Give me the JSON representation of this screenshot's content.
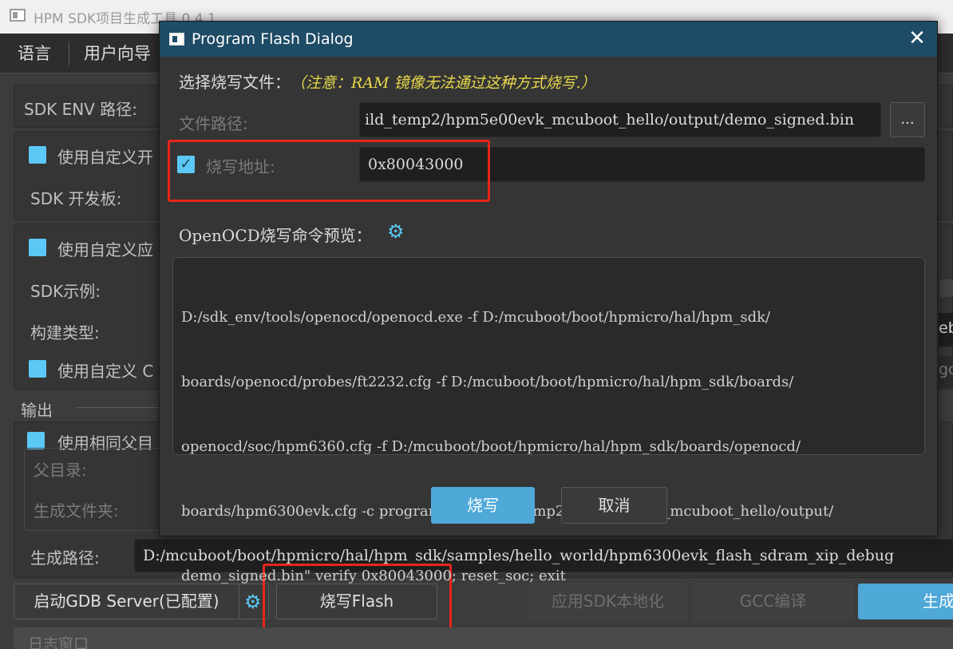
{
  "main_window": {
    "title": "HPM SDK项目生成工具 0.4.1",
    "menu": [
      "语言",
      "用户向导"
    ],
    "sdk_env_label": "SDK ENV 路径:",
    "custom_board_check": "使用自定义开",
    "sdk_board_label": "SDK 开发板:",
    "custom_app_check": "使用自定义应",
    "sdk_example_label": "SDK示例:",
    "build_type_label": "构建类型:",
    "custom_c_check": "使用自定义 C",
    "output_group": "输出",
    "same_parent_check": "使用相同父目",
    "parent_dir_label": "父目录:",
    "gen_folder_label": "生成文件夹:",
    "gen_path_label": "生成路径:",
    "gen_path_value": "D:/mcuboot/boot/hpmicro/hal/hpm_sdk/samples/hello_world/hpm6300evk_flash_sdram_xip_debug",
    "right_edge_fragment": "ebu",
    "right_edge_fragment2": "gc",
    "right_edge_fragment3": "具",
    "gdb_button": "启动GDB Server(已配置)",
    "flash_button": "烧写Flash",
    "localize_button": "应用SDK本地化",
    "gcc_button": "GCC编译",
    "generate_button": "生成",
    "log_window": "日志窗口"
  },
  "dialog": {
    "title": "Program Flash Dialog",
    "select_label": "选择烧写文件：",
    "note": "（注意：RAM 镜像无法通过这种方式烧写.）",
    "file_path_label": "文件路径:",
    "file_path_value": "ild_temp2/hpm5e00evk_mcuboot_hello/output/demo_signed.bin",
    "browse_button": "...",
    "address_label": "烧写地址:",
    "address_value": "0x80043000",
    "address_checked": true,
    "preview_label": "OpenOCD烧写命令预览：",
    "command_lines": [
      "D:/sdk_env/tools/openocd/openocd.exe -f D:/mcuboot/boot/hpmicro/hal/hpm_sdk/",
      "boards/openocd/probes/ft2232.cfg -f D:/mcuboot/boot/hpmicro/hal/hpm_sdk/boards/",
      "openocd/soc/hpm6360.cfg -f D:/mcuboot/boot/hpmicro/hal/hpm_sdk/boards/openocd/",
      "boards/hpm6300evk.cfg -c program \"D:/build_temp2/hpm5e00evk_mcuboot_hello/output/",
      "demo_signed.bin\" verify 0x80043000; reset_soc; exit"
    ],
    "flash_button": "烧写",
    "cancel_button": "取消"
  },
  "colors": {
    "dialog_title_bg": "#1e4b65",
    "accent": "#4ea8d8",
    "checkbox": "#5bc8f5",
    "note": "#e8d84a",
    "highlight": "#e8261b"
  }
}
